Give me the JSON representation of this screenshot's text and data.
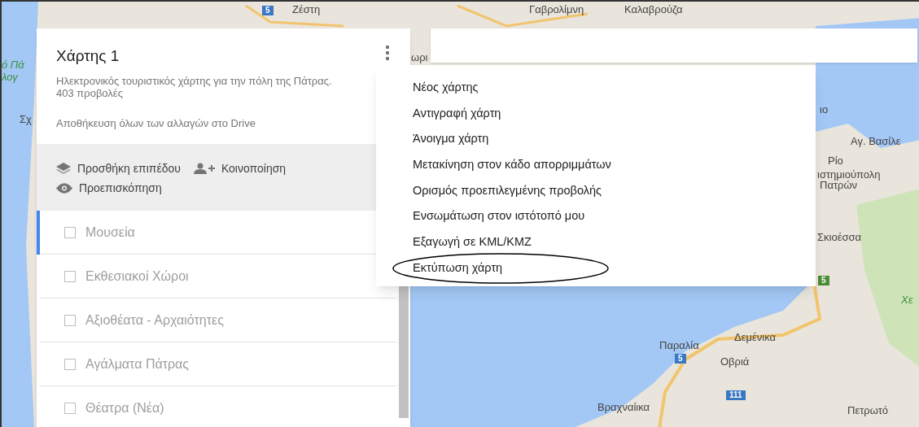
{
  "map": {
    "labels": [
      {
        "text": "Ζέστη",
        "kind": "place"
      },
      {
        "text": "Γαβρολίμνη",
        "kind": "place"
      },
      {
        "text": "Καλαβρούζα",
        "kind": "place"
      },
      {
        "text": "ό Πά",
        "kind": "park"
      },
      {
        "text": "λογ",
        "kind": "park"
      },
      {
        "text": "Σχ",
        "kind": "place"
      },
      {
        "text": "ωρι",
        "kind": "place"
      },
      {
        "text": "ιο",
        "kind": "place"
      },
      {
        "text": "Αγ. Βασίλε",
        "kind": "place"
      },
      {
        "text": "Ρίο",
        "kind": "place"
      },
      {
        "text": "ιστημιούπολη",
        "kind": "place"
      },
      {
        "text": "Πατρών",
        "kind": "place"
      },
      {
        "text": "Σκιοέσσα",
        "kind": "place"
      },
      {
        "text": "Χε",
        "kind": "park"
      },
      {
        "text": "Παραλία",
        "kind": "place"
      },
      {
        "text": "Δεμένικα",
        "kind": "place"
      },
      {
        "text": "Οβριά",
        "kind": "place"
      },
      {
        "text": "Βραχναίικα",
        "kind": "place"
      },
      {
        "text": "Πετρωτό",
        "kind": "place"
      }
    ],
    "shields": [
      {
        "text": "5",
        "color": "#3b78c4"
      },
      {
        "text": "5",
        "color": "#4c8c3a"
      },
      {
        "text": "5",
        "color": "#3b78c4"
      },
      {
        "text": "111",
        "color": "#3b78c4"
      }
    ]
  },
  "panel": {
    "title": "Χάρτης 1",
    "description": "Ηλεκτρονικός τουριστικός χάρτης για την πόλη της Πάτρας.",
    "views": "403 προβολές",
    "save_status": "Αποθήκευση όλων των αλλαγών στο Drive",
    "actions": [
      {
        "kind": "layers",
        "label": "Προσθήκη επιπέδου"
      },
      {
        "kind": "share",
        "label": "Κοινοποίηση"
      },
      {
        "kind": "preview",
        "label": "Προεπισκόπηση"
      }
    ],
    "layers": [
      {
        "name": "Μουσεία",
        "selected": true,
        "checked": false
      },
      {
        "name": "Εκθεσιακοί Χώροι",
        "selected": false,
        "checked": false
      },
      {
        "name": "Αξιοθέατα - Αρχαιότητες",
        "selected": false,
        "checked": false
      },
      {
        "name": "Αγάλματα Πάτρας",
        "selected": false,
        "checked": false
      },
      {
        "name": "Θέατρα (Νέα)",
        "selected": false,
        "checked": false
      }
    ]
  },
  "menu": {
    "items": [
      {
        "label": "Νέος χάρτης",
        "circled": false
      },
      {
        "label": "Αντιγραφή χάρτη",
        "circled": false
      },
      {
        "label": "Άνοιγμα χάρτη",
        "circled": false
      },
      {
        "label": "Μετακίνηση στον κάδο απορριμμάτων",
        "circled": false
      },
      {
        "label": "Ορισμός προεπιλεγμένης προβολής",
        "circled": false
      },
      {
        "label": "Ενσωμάτωση στον ιστότοπό μου",
        "circled": false
      },
      {
        "label": "Εξαγωγή σε KML/KMZ",
        "circled": false
      },
      {
        "label": "Εκτύπωση χάρτη",
        "circled": true
      }
    ]
  }
}
